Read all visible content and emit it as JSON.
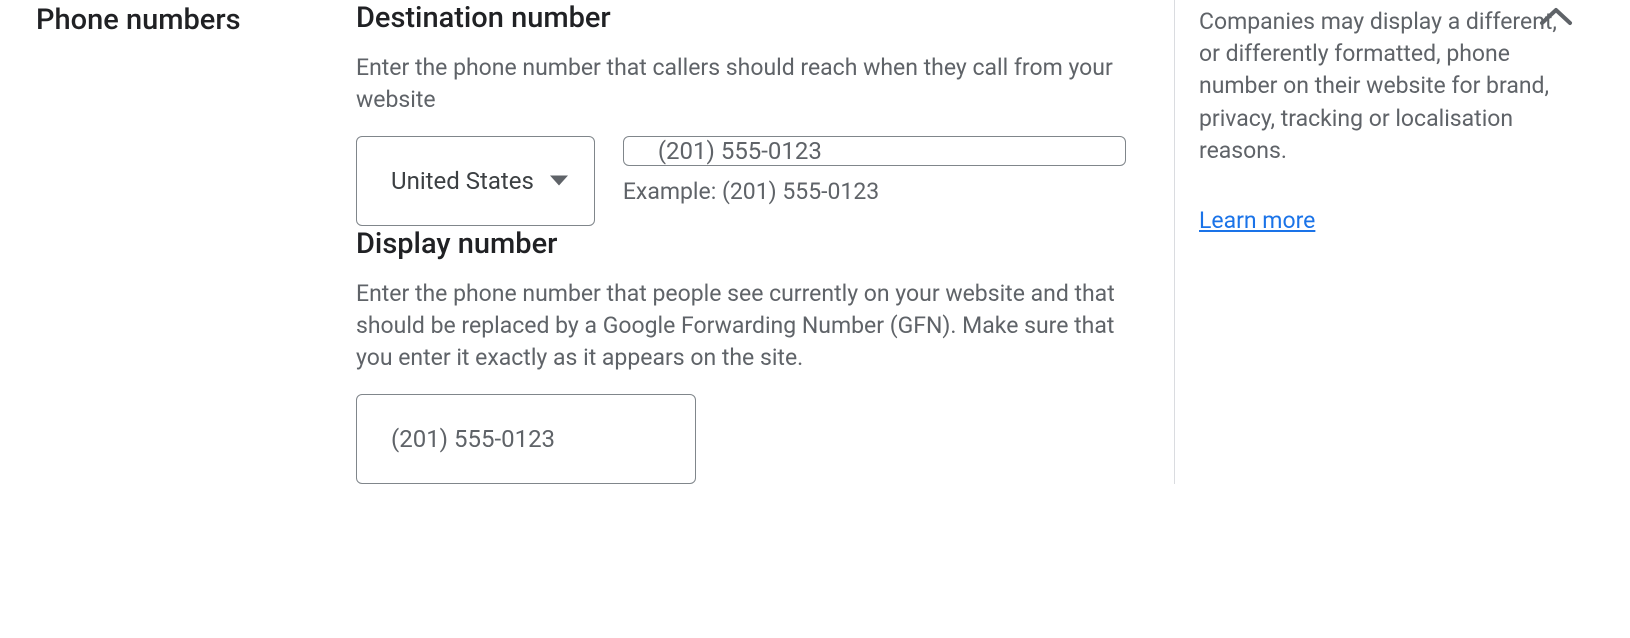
{
  "sidebar": {
    "section_label": "Phone numbers"
  },
  "destination": {
    "heading": "Destination number",
    "description": "Enter the phone number that callers should reach when they call from your website",
    "country_selected": "United States",
    "phone_placeholder": "(201) 555-0123",
    "example_label": "Example: (201) 555-0123"
  },
  "display": {
    "heading": "Display number",
    "description": "Enter the phone number that people see currently on your website and that should be replaced by a Google Forwarding Number (GFN). Make sure that you enter it exactly as it appears on the site.",
    "phone_placeholder": "(201) 555-0123"
  },
  "tip": {
    "text": "Companies may display a different, or differently formatted, phone number on their website for brand, privacy, tracking or localisation reasons.",
    "learn_more": "Learn more"
  }
}
